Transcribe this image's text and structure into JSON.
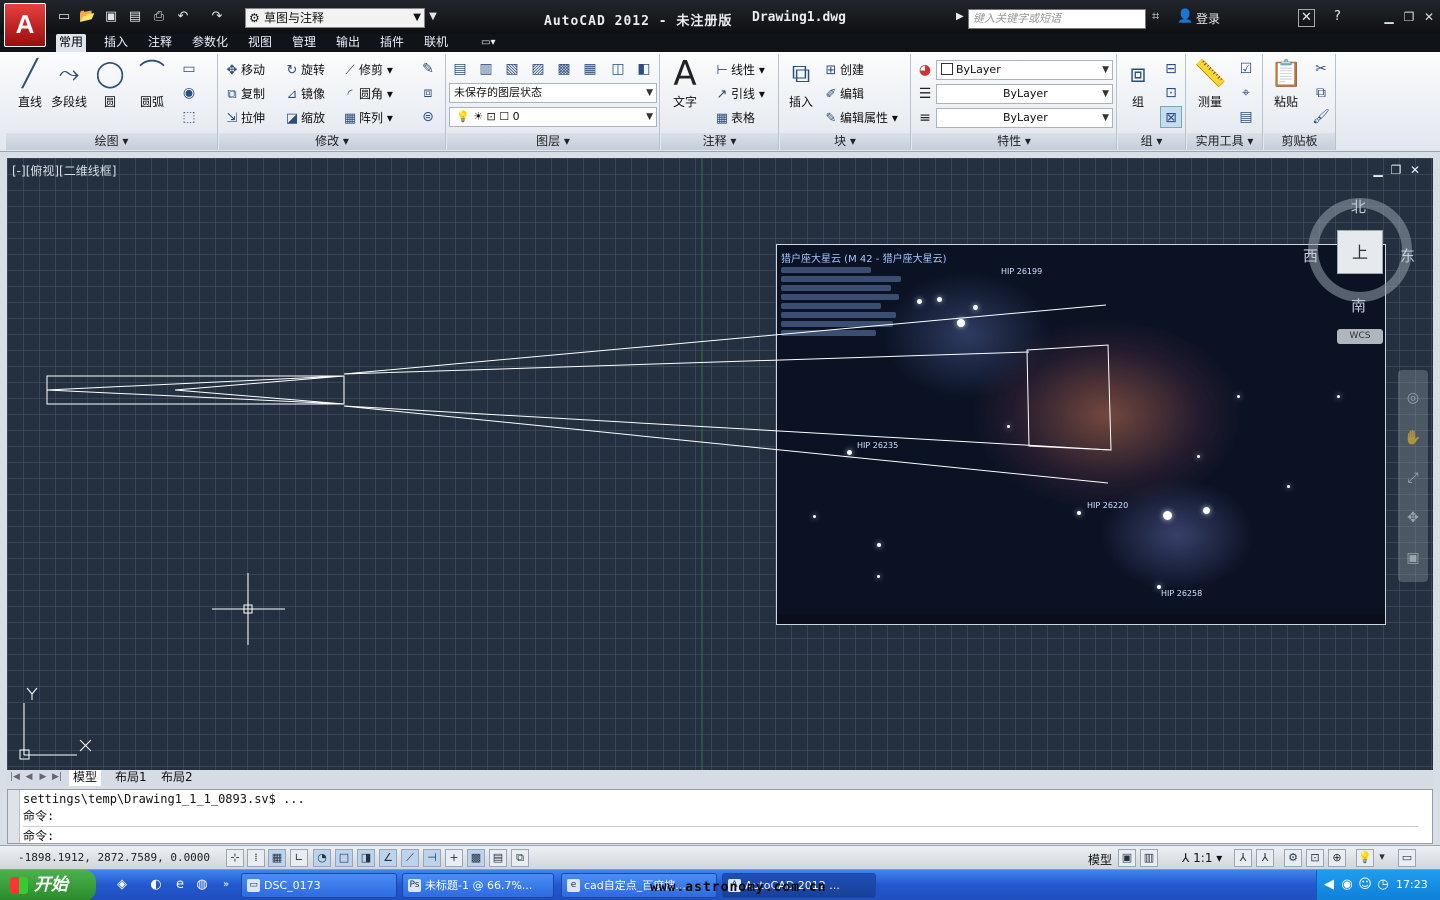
{
  "titlebar": {
    "logo": "A",
    "workspace": "草图与注释",
    "app_title": "AutoCAD 2012 - 未注册版",
    "document": "Drawing1.dwg",
    "search_placeholder": "键入关键字或短语",
    "login": "登录"
  },
  "tabs": [
    "常用",
    "插入",
    "注释",
    "参数化",
    "视图",
    "管理",
    "输出",
    "插件",
    "联机"
  ],
  "ribbon": {
    "draw": {
      "title": "绘图",
      "line": "直线",
      "polyline": "多段线",
      "circle": "圆",
      "arc": "圆弧"
    },
    "modify": {
      "title": "修改",
      "move": "移动",
      "rotate": "旋转",
      "trim": "修剪",
      "copy": "复制",
      "mirror": "镜像",
      "fillet": "圆角",
      "stretch": "拉伸",
      "scale": "缩放",
      "array": "阵列"
    },
    "layers": {
      "title": "图层",
      "state": "未保存的图层状态",
      "current_layer": "0"
    },
    "annotation": {
      "title": "注释",
      "text": "文字",
      "linear": "线性",
      "leader": "引线",
      "table": "表格"
    },
    "block": {
      "title": "块",
      "insert": "插入",
      "create": "创建",
      "edit": "编辑",
      "edit_attr": "编辑属性"
    },
    "properties": {
      "title": "特性",
      "color": "ByLayer",
      "linetype": "ByLayer",
      "lineweight": "ByLayer"
    },
    "groups": {
      "title": "组",
      "group": "组"
    },
    "utilities": {
      "title": "实用工具",
      "measure": "测量"
    },
    "clipboard": {
      "title": "剪贴板",
      "paste": "粘贴"
    }
  },
  "viewport": {
    "label": "[-][俯视][二维线框]",
    "compass": {
      "north": "北",
      "south": "南",
      "east": "东",
      "west": "西",
      "top": "上"
    },
    "wcs": "WCS",
    "ucs_x": "X",
    "ucs_y": "Y"
  },
  "photo": {
    "title": "猎户座大星云 (M 42 - 猎户座大星云)",
    "labels": [
      "HIP 26199",
      "HIP 26235",
      "HIP 26220",
      "HIP 26258"
    ]
  },
  "layout_tabs": [
    "模型",
    "布局1",
    "布局2"
  ],
  "command": {
    "history1": "settings\\temp\\Drawing1_1_1_0893.sv$ ...",
    "history2": "命令:",
    "prompt": "命令:"
  },
  "status": {
    "coords": "-1898.1912, 2872.7589, 0.0000",
    "model": "模型",
    "scale": "1:1"
  },
  "taskbar": {
    "start": "开始",
    "tasks": [
      "DSC_0173",
      "未标题-1 @ 66.7%...",
      "cad自定点_百度搜...",
      "AutoCAD 2012 ..."
    ],
    "clock": "17:23",
    "watermark": "www.astronomy.com.cn"
  }
}
